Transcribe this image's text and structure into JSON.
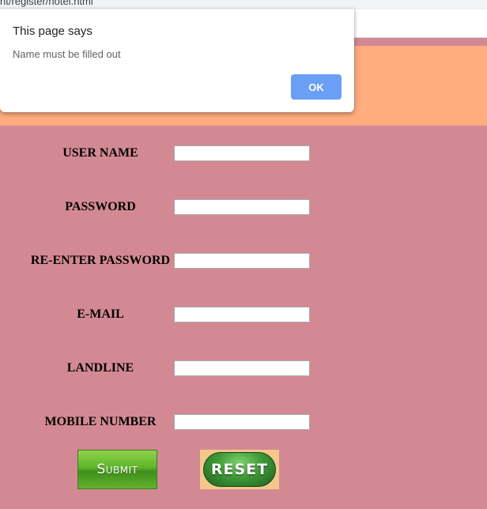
{
  "browser": {
    "url_fragment": "nt/register/hotel.html"
  },
  "dialog": {
    "title": "This page says",
    "message": "Name must be filled out",
    "ok_label": "OK"
  },
  "form": {
    "fields": [
      {
        "label": "USER NAME",
        "value": ""
      },
      {
        "label": "PASSWORD",
        "value": ""
      },
      {
        "label": "RE-ENTER PASSWORD",
        "value": ""
      },
      {
        "label": "E-MAIL",
        "value": ""
      },
      {
        "label": "LANDLINE",
        "value": ""
      },
      {
        "label": "MOBILE NUMBER",
        "value": ""
      }
    ],
    "submit_label": "Submit",
    "reset_label": "RESET"
  },
  "colors": {
    "page_background": "#d38994",
    "header_band": "#ffac7e",
    "ok_button": "#6a9ff5"
  }
}
